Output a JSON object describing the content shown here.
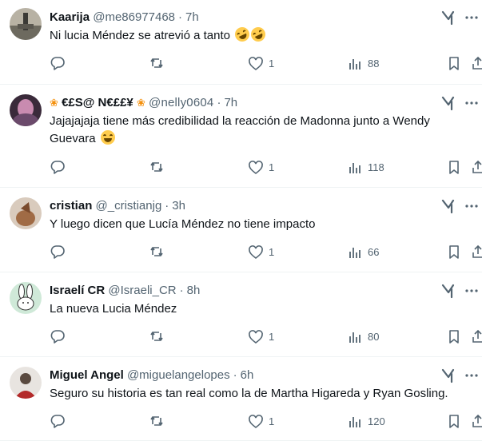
{
  "tweets": [
    {
      "name": "Kaarija",
      "handle": "@me86977468",
      "time": "7h",
      "text": "Ni lucia Méndez se atrevió a tanto",
      "emojis": [
        "rofl-emoji",
        "rofl-emoji"
      ],
      "likes": "1",
      "views": "88"
    },
    {
      "name": "€£S@ N€££¥",
      "handle": "@nelly0604",
      "time": "7h",
      "text": "Jajajajaja tiene más credibilidad la reacción de Madonna junto a Wendy Guevara",
      "emojis": [
        "grin-emoji"
      ],
      "likes": "1",
      "views": "118"
    },
    {
      "name": "cristian",
      "handle": "@_cristianjg",
      "time": "3h",
      "text": "Y luego dicen que Lucía Méndez no tiene impacto",
      "likes": "1",
      "views": "66"
    },
    {
      "name": "Israelí CR",
      "handle": "@Israeli_CR",
      "time": "8h",
      "text": "La nueva Lucia Méndez",
      "likes": "1",
      "views": "80"
    },
    {
      "name": "Miguel Angel",
      "handle": "@miguelangelopes",
      "time": "6h",
      "text": "Seguro su historia es tan real como la de Martha Higareda y Ryan Gosling.",
      "likes": "1",
      "views": "120"
    }
  ],
  "separator": "·",
  "colors": {
    "text": "#0f1419",
    "muted": "#536471",
    "divider": "#eff3f4"
  }
}
